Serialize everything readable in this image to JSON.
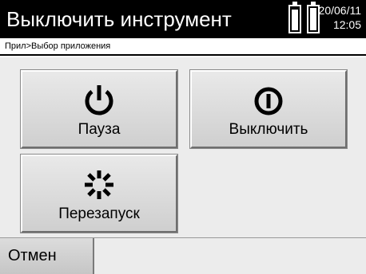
{
  "header": {
    "title": "Выключить инструмент",
    "date": "20/06/11",
    "time": "12:05",
    "battery_icons": [
      "battery-icon",
      "battery-icon"
    ]
  },
  "breadcrumb": "Прил>Выбор приложения",
  "tiles": [
    {
      "label": "Пауза",
      "icon": "power-icon"
    },
    {
      "label": "Выключить",
      "icon": "power-off-icon"
    },
    {
      "label": "Перезапуск",
      "icon": "restart-spinner-icon"
    }
  ],
  "softkeys": {
    "cancel_label": "Отмен"
  },
  "colors": {
    "titlebar_bg": "#000000",
    "content_bg": "#ececec",
    "button_face": "#dcdcdc"
  }
}
